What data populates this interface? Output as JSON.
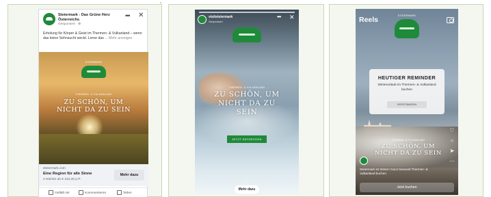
{
  "facebook_post": {
    "page_name": "Steiermark - Das Grüne Herz Österreichs",
    "sponsored": "Gesponsert · ⊕",
    "more_icon": "ellipsis-icon",
    "close_icon": "close-icon",
    "body_text": "Erholung für Körper & Geist im Thermen- & Vulkanland – wenn das keine Sehnsucht weckt. Lerne das",
    "body_more": "... Mehr anzeigen",
    "logo_top": "STEIERMARK",
    "headline_top": "THERMEN- & VULKANLAND",
    "headline_line1": "ZU SCHÖN, UM",
    "headline_line2": "NICHT DA ZU SEIN",
    "link_domain": "steiermark.com",
    "link_title": "Eine Region für alle Sinne",
    "link_subtitle": "2 Nächte ab € 194,30 p.P.",
    "cta_label": "Mehr dazu",
    "actions": [
      "Gefällt mir",
      "Kommentieren",
      "Teilen"
    ]
  },
  "story": {
    "account_name": "visitsteiermark",
    "account_sub": "Gesponsert",
    "logo_text": "Steiermark",
    "headline_top": "THERMEN- & VULKANLAND",
    "headline_line1": "ZU SCHÖN, UM",
    "headline_line2": "NICHT DA ZU",
    "headline_line3": "SEIN",
    "button_label": "JETZT ENTDECKEN",
    "cta_label": "Mehr dazu",
    "swipe_icon": "chevron-up-icon"
  },
  "reels": {
    "title": "Reels",
    "camera_icon": "camera-icon",
    "logo_top": "STEIERMARK",
    "card_title": "HEUTIGER REMINDER",
    "card_text": "Winterurlaub im Thermen- & Vulkanland buchen",
    "card_button": "VERSTANDEN",
    "headline_top": "THERMEN- & VULKANLAND",
    "headline_line1": "ZU SCHÖN, UM",
    "headline_line2": "NICHT DA ZU SEIN",
    "side_icons": [
      "heart-icon",
      "comment-icon",
      "share-icon",
      "more-icon"
    ],
    "caption": "Steiermark ist Winter! Ganz bewusst Thermen- & Vulkanland buchen",
    "button_label": "Jetzt buchen"
  },
  "colors": {
    "brand_green": "#1f8a3a",
    "frame_border": "#c9d5b0"
  }
}
